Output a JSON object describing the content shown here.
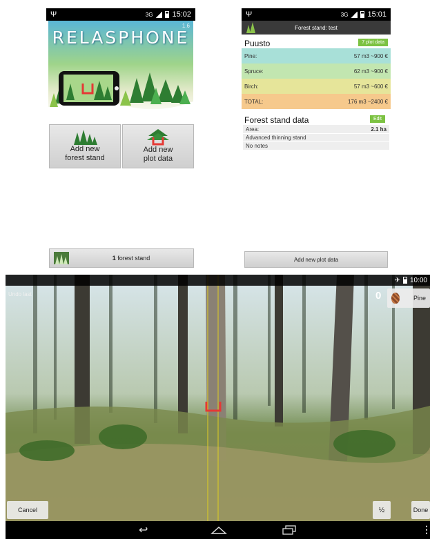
{
  "screen1": {
    "status": {
      "usb_icon": "usb-icon",
      "network": "3G",
      "time": "15:02"
    },
    "version": "1.6",
    "logo_text": "RELASPHONE",
    "buttons": {
      "add_forest_stand": "Add new\nforest stand",
      "add_plot_data": "Add new\nplot data"
    },
    "footer": {
      "count": "1",
      "label": "forest stand"
    }
  },
  "screen2": {
    "status": {
      "usb_icon": "usb-icon",
      "network": "3G",
      "time": "15:01"
    },
    "title": "Forest stand: test",
    "puusto": {
      "heading": "Puusto",
      "badge": "7 plot data",
      "rows": [
        {
          "label": "Pine:",
          "value": "57 m3 ~900 €",
          "color": "#a8e0d8"
        },
        {
          "label": "Spruce:",
          "value": "62 m3 ~900 €",
          "color": "#c2e6b0"
        },
        {
          "label": "Birch:",
          "value": "57 m3 ~600 €",
          "color": "#e6e59a"
        },
        {
          "label": "TOTAL:",
          "value": "176 m3 ~2400 €",
          "color": "#f6c98c"
        }
      ]
    },
    "stand_data": {
      "heading": "Forest stand data",
      "edit": "Edit",
      "area_label": "Area:",
      "area_value": "2.1 ha",
      "type": "Advanced thinning stand",
      "notes": "No notes"
    },
    "footer_button": "Add new plot data"
  },
  "screen3": {
    "status_time": "10:00",
    "top_left": "Undo last",
    "count": "0",
    "species": "Pine",
    "buttons": {
      "cancel": "Cancel",
      "half": "½",
      "done": "Done"
    }
  }
}
